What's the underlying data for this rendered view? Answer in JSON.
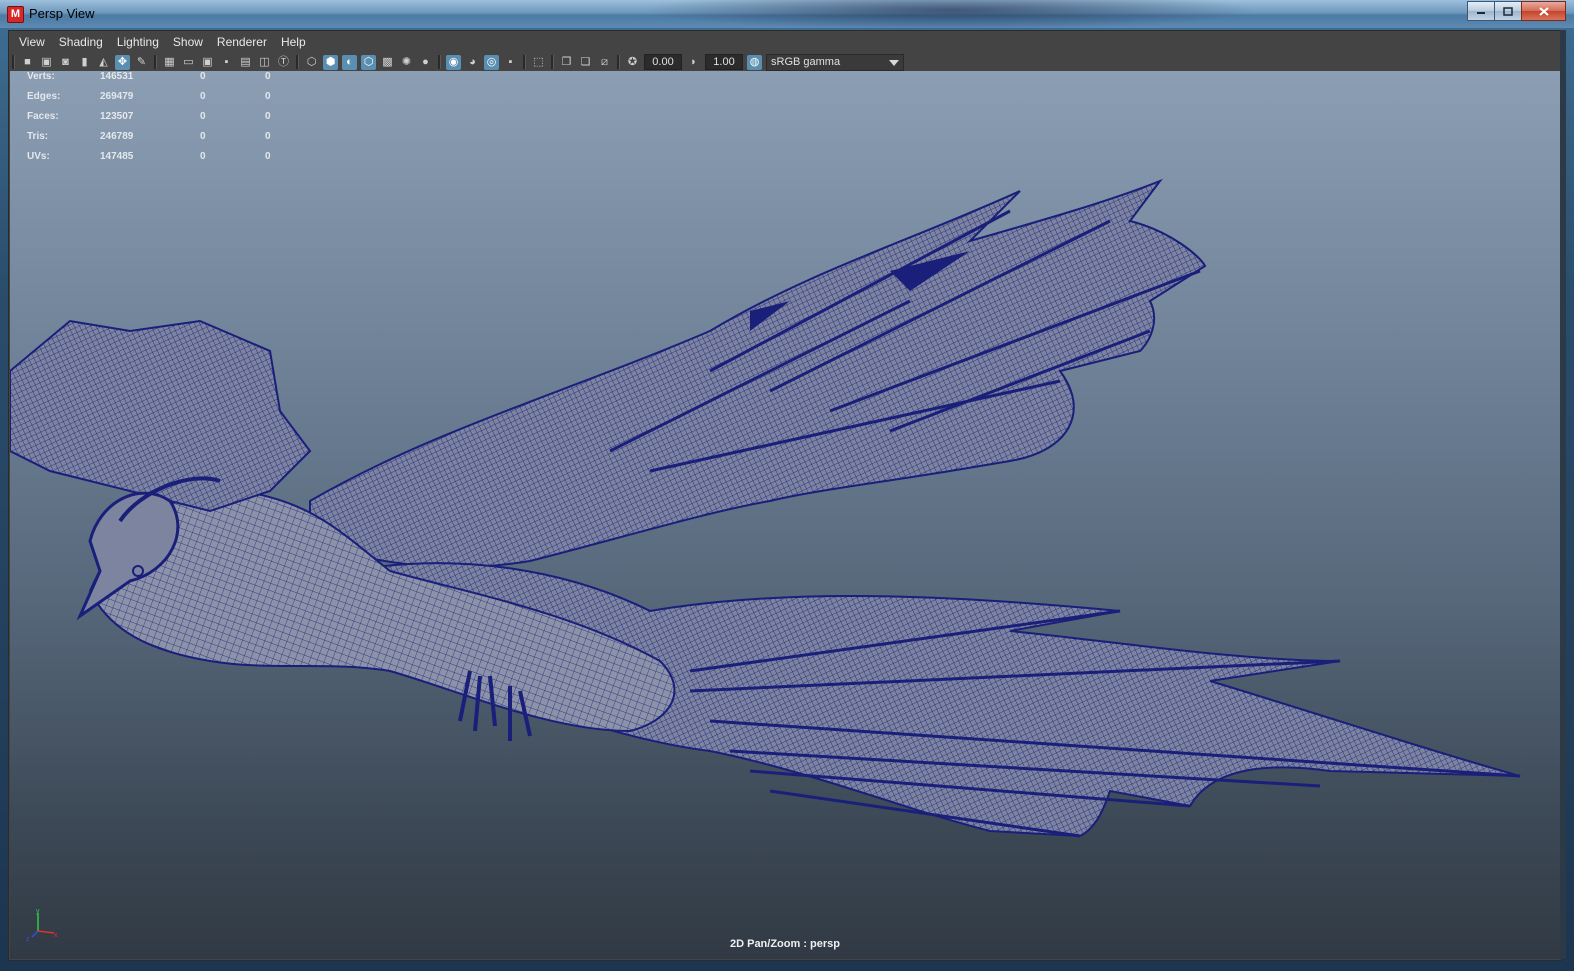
{
  "window": {
    "title": "Persp View",
    "app_icon_letter": "M"
  },
  "menu": [
    "View",
    "Shading",
    "Lighting",
    "Show",
    "Renderer",
    "Help"
  ],
  "toolbar": {
    "exposure": "0.00",
    "gamma": "1.00",
    "color_space": "sRGB gamma"
  },
  "hud": {
    "rows": [
      {
        "label": "Verts:",
        "v1": "146531",
        "v2": "0",
        "v3": "0"
      },
      {
        "label": "Edges:",
        "v1": "269479",
        "v2": "0",
        "v3": "0"
      },
      {
        "label": "Faces:",
        "v1": "123507",
        "v2": "0",
        "v3": "0"
      },
      {
        "label": "Tris:",
        "v1": "246789",
        "v2": "0",
        "v3": "0"
      },
      {
        "label": "UVs:",
        "v1": "147485",
        "v2": "0",
        "v3": "0"
      }
    ]
  },
  "viewport": {
    "camera_label": "2D Pan/Zoom : persp",
    "wire_color": "#1a1f7a",
    "mesh_color": "#8c93a8"
  },
  "colors": {
    "accent": "#5b8fb1",
    "close": "#c1452c"
  }
}
